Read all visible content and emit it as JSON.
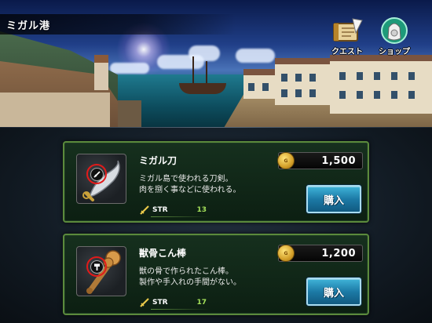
{
  "header": {
    "location_title": "ミガル港"
  },
  "menu": {
    "quest_label": "クエスト",
    "quest_icon": "quest-book-icon",
    "shop_label": "ショップ",
    "shop_icon": "shop-bag-icon"
  },
  "currency": {
    "coin_text": "G",
    "coin_icon": "gold-coin-icon"
  },
  "items": [
    {
      "name": "ミガル刀",
      "price": "1,500",
      "description_line1": "ミガル島で使われる刀剣。",
      "description_line2": "肉を捌く事などに使われる。",
      "stat_label": "STR",
      "stat_value": "13",
      "weapon_type_icon": "sword-icon",
      "item_icon": "scimitar-icon",
      "buy_label": "購入"
    },
    {
      "name": "獣骨こん棒",
      "price": "1,200",
      "description_line1": "獣の骨で作られたこん棒。",
      "description_line2": "製作や手入れの手間がない。",
      "stat_label": "STR",
      "stat_value": "17",
      "weapon_type_icon": "hammer-icon",
      "item_icon": "bone-club-icon",
      "buy_label": "購入"
    }
  ],
  "colors": {
    "card_border": "#5b8a3c",
    "stat_value": "#a4e05a",
    "buy_button": "#1c7aa6",
    "highlight_circle": "#e21a1a"
  }
}
